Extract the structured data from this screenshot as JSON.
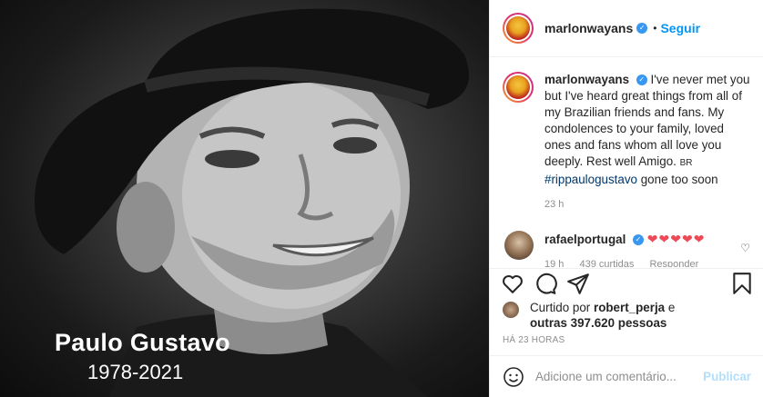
{
  "photo": {
    "name": "Paulo Gustavo",
    "years": "1978-2021"
  },
  "header": {
    "username": "marlonwayans",
    "follow_label": "Seguir",
    "separator": "•"
  },
  "caption": {
    "username": "marlonwayans",
    "text": "I've never met you but I've heard great things from all of my Brazilian friends and fans. My condolences to your family, loved ones and fans whom all love you deeply. Rest well Amigo.",
    "flag": "BR",
    "hashtag": "#rippaulogustavo",
    "tail": "gone too soon",
    "time": "23 h"
  },
  "reply": {
    "username": "rafaelportugal",
    "hearts": "❤❤❤❤❤",
    "time": "19 h",
    "likes": "439 curtidas",
    "reply_label": "Responder"
  },
  "likes": {
    "prefix": "Curtido por",
    "user": "robert_perja",
    "joiner": "e",
    "others": "outras 397.620 pessoas"
  },
  "timestamp": "HÁ 23 HORAS",
  "add_comment": {
    "placeholder": "Adicione um comentário...",
    "publish_label": "Publicar"
  },
  "icons": [
    "heart-icon",
    "comment-icon",
    "share-icon",
    "bookmark-icon",
    "emoji-icon",
    "verified-icon"
  ],
  "colors": {
    "accent": "#0095f6",
    "heart": "#ed4956",
    "muted": "#8e8e8e",
    "publish_disabled": "#b2dffc"
  }
}
